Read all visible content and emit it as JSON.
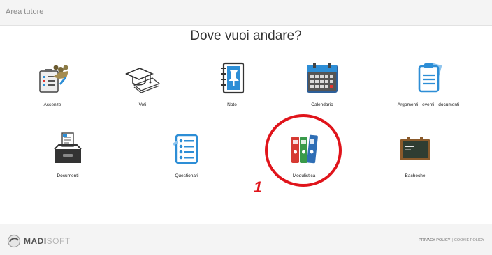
{
  "header": {
    "title": "Area tutore"
  },
  "main": {
    "heading": "Dove vuoi andare?",
    "tiles": [
      {
        "label": "Assenze",
        "icon": "attendance-icon"
      },
      {
        "label": "Voti",
        "icon": "graduation-cap-icon"
      },
      {
        "label": "Note",
        "icon": "pinned-note-icon"
      },
      {
        "label": "Calendario",
        "icon": "calendar-icon"
      },
      {
        "label": "Argomenti - eventi - documenti",
        "icon": "clipboard-icon"
      },
      {
        "label": "Documenti",
        "icon": "document-tray-icon"
      },
      {
        "label": "Questionari",
        "icon": "questionnaire-icon"
      },
      {
        "label": "Modulistica",
        "icon": "binders-icon"
      },
      {
        "label": "Bacheche",
        "icon": "chalkboard-icon"
      }
    ]
  },
  "annotation": {
    "number": "1",
    "color": "#e0141b"
  },
  "footer": {
    "logo_bold": "MADI",
    "logo_light": "SOFT",
    "privacy": "PRIVACY POLICY",
    "separator": "|",
    "cookie": "COOKIE POLICY"
  }
}
